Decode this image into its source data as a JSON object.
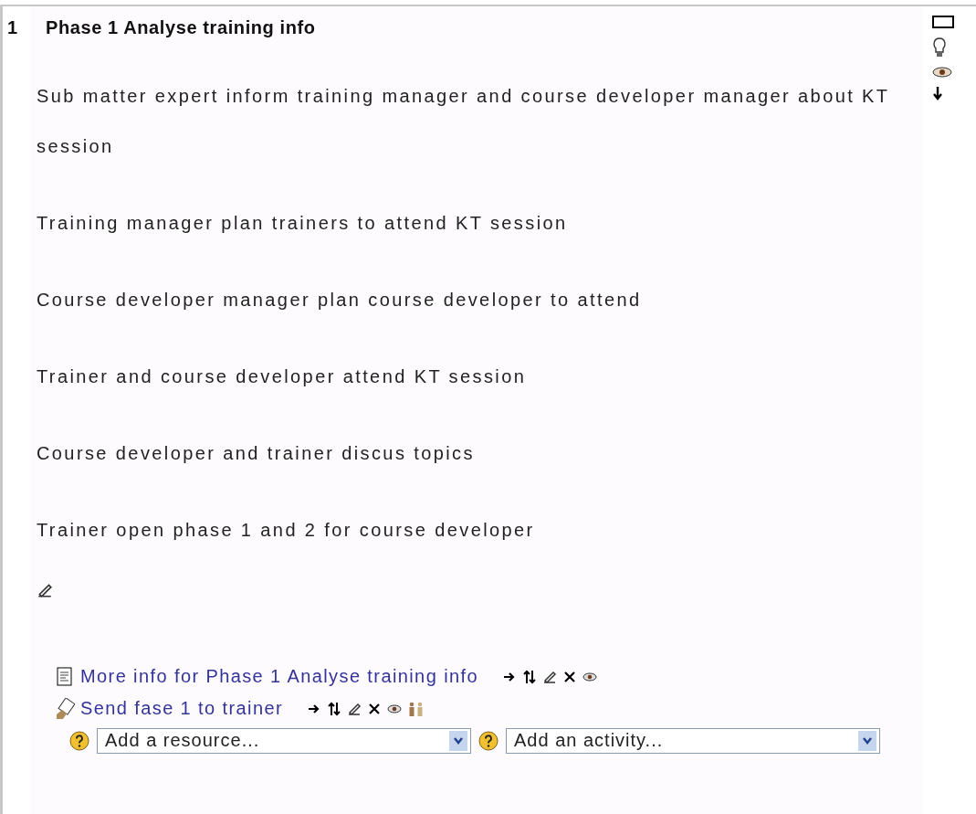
{
  "section": {
    "number": "1",
    "title": "Phase 1 Analyse training info",
    "paragraphs": [
      "Sub matter expert inform training manager and course developer manager about KT session",
      "Training manager plan trainers to attend KT session",
      "Course developer manager plan course developer to attend",
      "Trainer and course developer attend KT session",
      "Course developer and trainer discus topics",
      "Trainer open phase 1 and 2 for course developer"
    ],
    "activities": [
      {
        "kind": "resource",
        "label": "More info for Phase 1 Analyse training info",
        "group_mode": false
      },
      {
        "kind": "assignment",
        "label": "Send fase 1 to trainer",
        "group_mode": true
      }
    ],
    "add_menus": [
      {
        "value": "Add a resource..."
      },
      {
        "value": "Add an activity..."
      }
    ]
  }
}
